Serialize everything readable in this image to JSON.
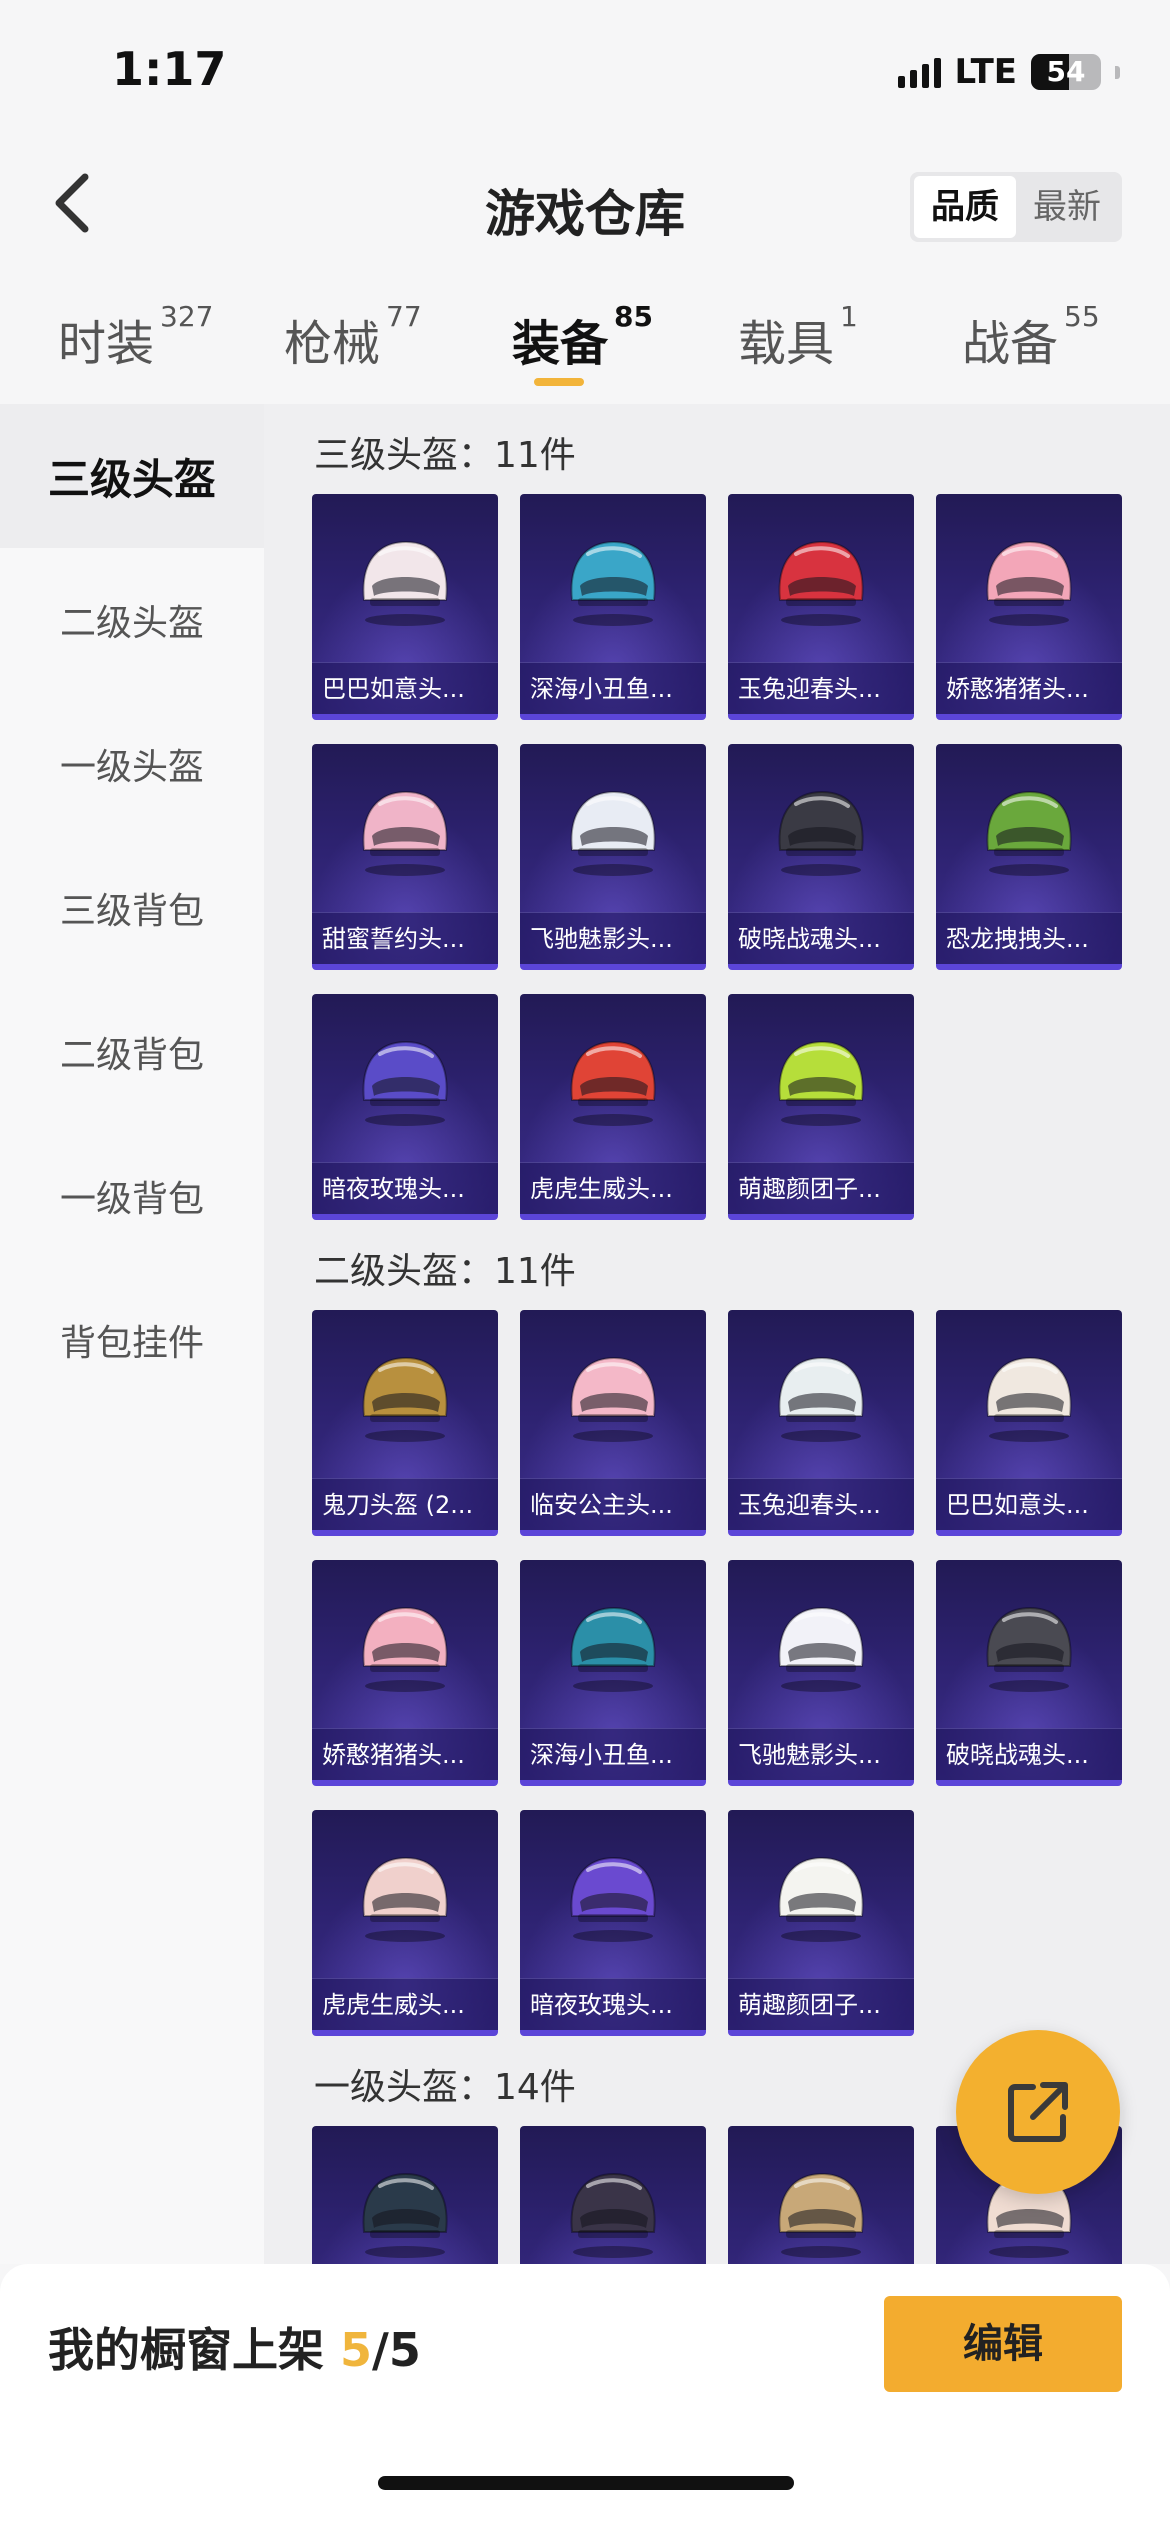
{
  "status": {
    "time": "1:17",
    "network": "LTE",
    "battery": "54",
    "battery_level": 0.54
  },
  "header": {
    "title": "游戏仓库",
    "sort_options": [
      {
        "label": "品质",
        "active": true
      },
      {
        "label": "最新",
        "active": false
      }
    ]
  },
  "tabs": [
    {
      "label": "时装",
      "count": "327"
    },
    {
      "label": "枪械",
      "count": "77"
    },
    {
      "label": "装备",
      "count": "85"
    },
    {
      "label": "载具",
      "count": "1"
    },
    {
      "label": "战备",
      "count": "55"
    }
  ],
  "sidebar": {
    "items": [
      {
        "label": "三级头盔"
      },
      {
        "label": "二级头盔"
      },
      {
        "label": "一级头盔"
      },
      {
        "label": "三级背包"
      },
      {
        "label": "二级背包"
      },
      {
        "label": "一级背包"
      },
      {
        "label": "背包挂件"
      }
    ]
  },
  "sections": [
    {
      "title": "三级头盔：11件",
      "items": [
        {
          "name": "巴巴如意头..."
        },
        {
          "name": "深海小丑鱼..."
        },
        {
          "name": "玉兔迎春头..."
        },
        {
          "name": "娇憨猪猪头..."
        },
        {
          "name": "甜蜜誓约头..."
        },
        {
          "name": "飞驰魅影头..."
        },
        {
          "name": "破晓战魂头..."
        },
        {
          "name": "恐龙拽拽头..."
        },
        {
          "name": "暗夜玫瑰头..."
        },
        {
          "name": "虎虎生威头..."
        },
        {
          "name": "萌趣颜团子..."
        }
      ]
    },
    {
      "title": "二级头盔：11件",
      "items": [
        {
          "name": "鬼刀头盔 (2..."
        },
        {
          "name": "临安公主头..."
        },
        {
          "name": "玉兔迎春头..."
        },
        {
          "name": "巴巴如意头..."
        },
        {
          "name": "娇憨猪猪头..."
        },
        {
          "name": "深海小丑鱼..."
        },
        {
          "name": "飞驰魅影头..."
        },
        {
          "name": "破晓战魂头..."
        },
        {
          "name": "虎虎生威头..."
        },
        {
          "name": "暗夜玫瑰头..."
        },
        {
          "name": "萌趣颜团子..."
        }
      ]
    },
    {
      "title": "一级头盔：14件",
      "items": [
        {
          "name": ""
        },
        {
          "name": ""
        },
        {
          "name": ""
        },
        {
          "name": ""
        }
      ]
    }
  ],
  "helmet_colors": [
    "#f2e6ea",
    "#3aa6c8",
    "#d8333f",
    "#f3a6b8",
    "#f0b4c8",
    "#e8ecf4",
    "#3a3a44",
    "#6aa83c",
    "#5a4cc8",
    "#e04436",
    "#b6de3a",
    "#b8903e",
    "#f4b8c8",
    "#e8eef0",
    "#f0e8e0",
    "#f3b0c0",
    "#2b8fa8",
    "#f2f2f8",
    "#4a4a52",
    "#f0d0cc",
    "#6a4ad0",
    "#f4f4f0",
    "#2a3a4a",
    "#3a3448",
    "#c8a878",
    "#f0dcd2"
  ],
  "bottom": {
    "showcase_label": "我的橱窗上架",
    "showcase_count": "5",
    "showcase_total": "/5",
    "edit_label": "编辑"
  }
}
